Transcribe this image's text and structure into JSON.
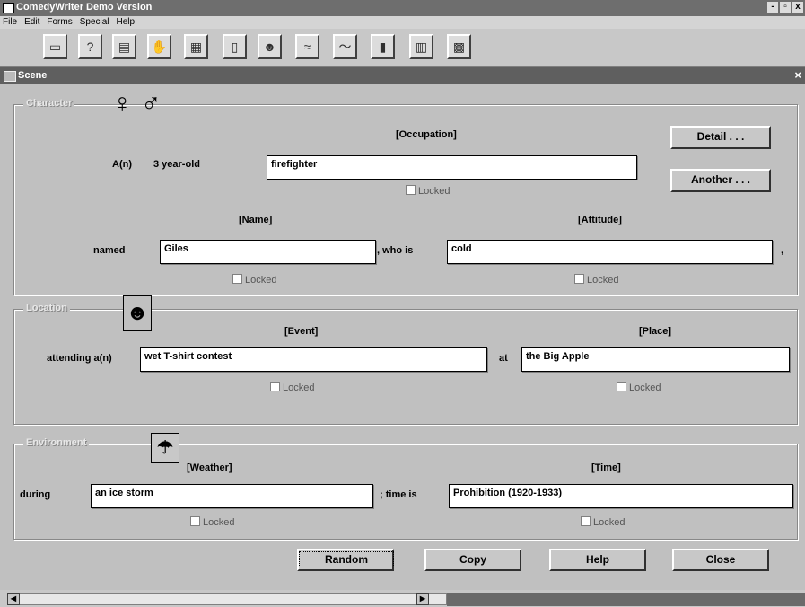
{
  "app": {
    "title": "ComedyWriter Demo Version",
    "window_buttons": [
      "-",
      "▫",
      "x"
    ]
  },
  "menu": [
    "File",
    "Edit",
    "Forms",
    "Special",
    "Help"
  ],
  "toolbar": [
    "▭",
    "?",
    "▤",
    "✋",
    "▦",
    "▯",
    "☻",
    "≈",
    "〜",
    "▮",
    "▥",
    "▩"
  ],
  "scene": {
    "title": "Scene",
    "close": "×"
  },
  "character": {
    "legend": "Character",
    "female_symbol": "♀",
    "male_symbol": "♂",
    "occupation_header": "[Occupation]",
    "a_label": "A(n)",
    "age": "3 year-old",
    "occupation_value": "firefighter",
    "occupation_locked": "Locked",
    "detail_btn": "Detail . . .",
    "another_btn": "Another . . .",
    "name_header": "[Name]",
    "attitude_header": "[Attitude]",
    "named_label": "named",
    "name_value": "Giles",
    "who_is_label": ", who is",
    "attitude_value": "cold",
    "comma": ",",
    "name_locked": "Locked",
    "attitude_locked": "Locked"
  },
  "location": {
    "legend": "Location",
    "event_header": "[Event]",
    "place_header": "[Place]",
    "attending_label": "attending a(n)",
    "event_value": "wet T-shirt contest",
    "at_label": "at",
    "place_value": "the Big Apple",
    "event_locked": "Locked",
    "place_locked": "Locked"
  },
  "environment": {
    "legend": "Environment",
    "weather_header": "[Weather]",
    "time_header": "[Time]",
    "during_label": "during",
    "weather_value": "an ice storm",
    "time_is_label": "; time is",
    "time_value": "Prohibition (1920-1933)",
    "weather_locked": "Locked",
    "time_locked": "Locked"
  },
  "buttons": {
    "random": "Random",
    "copy": "Copy",
    "help": "Help",
    "close": "Close"
  }
}
